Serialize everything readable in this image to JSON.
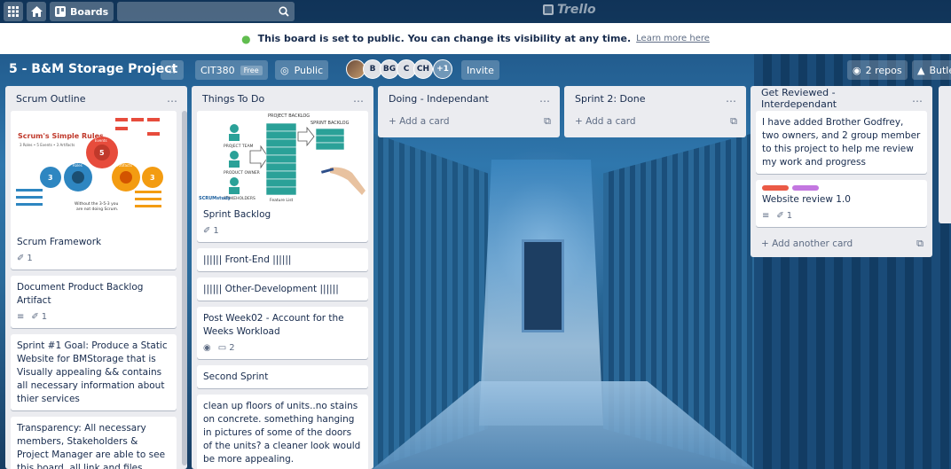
{
  "topbar": {
    "boards_label": "Boards",
    "logo_text": "Trello"
  },
  "notice": {
    "message": "This board is set to public. You can change its visibility at any time.",
    "learn_more": "Learn more here"
  },
  "board": {
    "title": "5 - B&M Storage Project",
    "team": "CIT380",
    "team_badge": "Free",
    "visibility": "Public",
    "members": [
      "B",
      "BG",
      "C",
      "CH"
    ],
    "more_members": "+1",
    "invite": "Invite",
    "repos": "2 repos",
    "butler": "Butle"
  },
  "lists": [
    {
      "title": "Scrum Outline",
      "cards": [
        {
          "title": "Scrum Framework",
          "attachments": "1",
          "has_cover": true
        },
        {
          "title": "Document Product Backlog Artifact",
          "attachments": "1",
          "has_description": true
        },
        {
          "title": "Sprint #1 Goal: Produce a Static Website for BMStorage that is Visually appealing && contains all necessary information about thier services"
        },
        {
          "title": "Transparency: All necessary members, Stakeholders & Project Manager are able to see this board, all link and files included will be turned to fully"
        }
      ]
    },
    {
      "title": "Things To Do",
      "cards": [
        {
          "title": "Sprint Backlog",
          "attachments": "1",
          "has_cover": true
        },
        {
          "title": "|||||| Front-End ||||||"
        },
        {
          "title": "|||||| Other-Development ||||||"
        },
        {
          "title": "Post Week02 - Account for the Weeks Workload",
          "comments": "2",
          "watching": true
        },
        {
          "title": "Second Sprint"
        },
        {
          "title": "clean up floors of units..no stains on concrete. something hanging in pictures of some of the doors of the units? a cleaner look would be more appealing.",
          "has_description": true
        }
      ]
    },
    {
      "title": "Doing - Independant",
      "add_card": "Add a card"
    },
    {
      "title": "Sprint 2: Done",
      "add_card": "Add a card"
    },
    {
      "title": "Get Reviewed - Interdependant",
      "cards": [
        {
          "title": "I have added Brother Godfrey, two owners, and 2 group member to this project to help me review my work and progress"
        },
        {
          "title": "Website review 1.0",
          "attachments": "1",
          "has_description": true
        }
      ],
      "add_card": "Add another card"
    }
  ],
  "scrum_image": {
    "heading": "Scrum's Simple Rules",
    "sub": "3 Roles • 5 Events • 3 Artifacts",
    "footer1": "Without the 3-5-3 you",
    "footer2": "are not doing Scrum.",
    "count5": "5",
    "count3a": "3",
    "count3b": "3",
    "events": "Events",
    "roles": "Roles",
    "artifacts": "Artifacts"
  },
  "backlog_image": {
    "project_backlog": "PROJECT BACKLOG",
    "sprint_backlog": "SPRINT BACKLOG",
    "project_team": "PROJECT TEAM",
    "product_owner": "PRODUCT OWNER",
    "stakeholders": "STAKEHOLDERS",
    "feature_list": "Feature List",
    "brand": "SCRUMstudy"
  },
  "colors": {
    "label_red": "#eb5a46",
    "label_purple": "#c377e0",
    "globe_green": "#61bd4f"
  }
}
